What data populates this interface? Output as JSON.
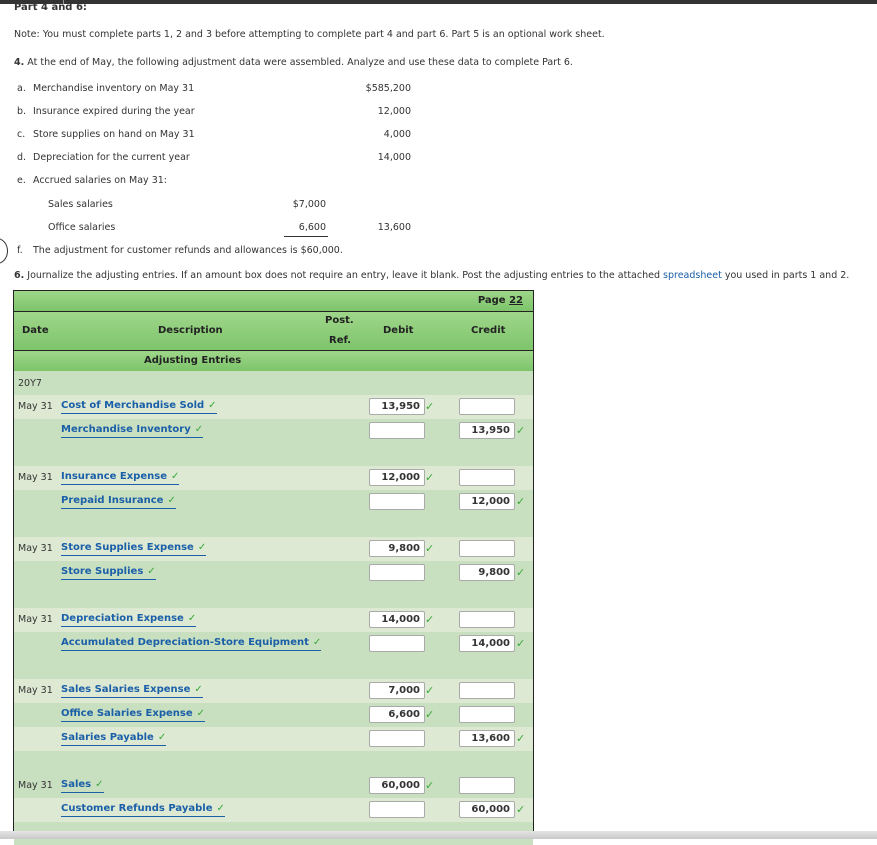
{
  "section_title": "Part 4 and 6:",
  "note": "Note: You must complete parts 1, 2 and 3 before attempting to complete part 4 and part 6. Part 5 is an optional work sheet.",
  "part4": {
    "number": "4.",
    "text": "At the end of May, the following adjustment data were assembled. Analyze and use these data to complete Part 6.",
    "items": [
      {
        "letter": "a.",
        "label": "Merchandise inventory on May 31",
        "amount": "$585,200"
      },
      {
        "letter": "b.",
        "label": "Insurance expired during the year",
        "amount": "12,000"
      },
      {
        "letter": "c.",
        "label": "Store supplies on hand on May 31",
        "amount": "4,000"
      },
      {
        "letter": "d.",
        "label": "Depreciation for the current year",
        "amount": "14,000"
      },
      {
        "letter": "e.",
        "label": "Accrued salaries on May 31:",
        "amount": ""
      }
    ],
    "salaries": [
      {
        "label": "Sales salaries",
        "amount": "$7,000"
      },
      {
        "label": "Office salaries",
        "amount": "6,600",
        "total": "13,600"
      }
    ],
    "item_f": {
      "letter": "f.",
      "label": "The adjustment for customer refunds and allowances is $60,000."
    }
  },
  "part6": {
    "number": "6.",
    "text_before": "Journalize the adjusting entries. If an amount box does not require an entry, leave it blank. Post the adjusting entries to the attached",
    "link": "spreadsheet",
    "text_after": "you used in parts 1 and 2."
  },
  "journal": {
    "page_label": "Page",
    "page_number": "22",
    "headers": {
      "date": "Date",
      "description": "Description",
      "post_ref_1": "Post.",
      "post_ref_2": "Ref.",
      "debit": "Debit",
      "credit": "Credit"
    },
    "subheader": "Adjusting Entries",
    "year": "20Y7",
    "check_glyph": "✓",
    "entries": [
      {
        "date": "May 31",
        "account": "Cost of Merchandise Sold",
        "debit": "13,950",
        "credit": ""
      },
      {
        "date": "",
        "account": "Merchandise Inventory",
        "debit": "",
        "credit": "13,950"
      },
      {
        "date": "May 31",
        "account": "Insurance Expense",
        "debit": "12,000",
        "credit": ""
      },
      {
        "date": "",
        "account": "Prepaid Insurance",
        "debit": "",
        "credit": "12,000"
      },
      {
        "date": "May 31",
        "account": "Store Supplies Expense",
        "debit": "9,800",
        "credit": ""
      },
      {
        "date": "",
        "account": "Store Supplies",
        "debit": "",
        "credit": "9,800"
      },
      {
        "date": "May 31",
        "account": "Depreciation Expense",
        "debit": "14,000",
        "credit": ""
      },
      {
        "date": "",
        "account": "Accumulated Depreciation-Store Equipment",
        "debit": "",
        "credit": "14,000"
      },
      {
        "date": "May 31",
        "account": "Sales Salaries Expense",
        "debit": "7,000",
        "credit": ""
      },
      {
        "date": "",
        "account": "Office Salaries Expense",
        "debit": "6,600",
        "credit": ""
      },
      {
        "date": "",
        "account": "Salaries Payable",
        "debit": "",
        "credit": "13,600"
      },
      {
        "date": "May 31",
        "account": "Sales",
        "debit": "60,000",
        "credit": ""
      },
      {
        "date": "",
        "account": "Customer Refunds Payable",
        "debit": "",
        "credit": "60,000"
      }
    ]
  },
  "colors": {
    "header_green": "#7cc46a",
    "row_light": "#dde9d3",
    "row_alt": "#c8dfc0",
    "link_blue": "#1a5fa8",
    "check_green": "#3aa83a"
  }
}
